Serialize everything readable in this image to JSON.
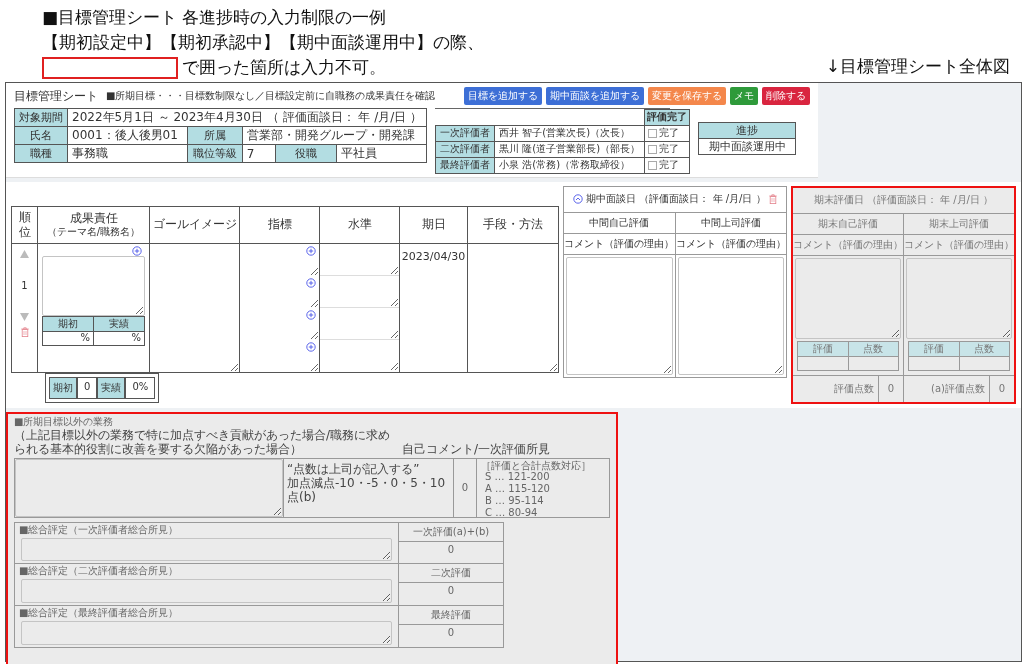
{
  "caption": {
    "title": "■目標管理シート 各進捗時の入力制限の一例",
    "line2": "【期初設定中】【期初承認中】【期中面談運用中】の際、",
    "line3": "で囲った箇所は入力不可。",
    "figure_label": "↓目標管理シート全体図"
  },
  "sheet": {
    "title": "目標管理シート",
    "note": "■所期目標・・・目標数制限なし／目標設定前に自職務の成果責任を確認",
    "buttons": [
      {
        "label": "目標を追加する",
        "color": "#3d6fd6"
      },
      {
        "label": "期中面談を追加する",
        "color": "#3d6fd6"
      },
      {
        "label": "変更を保存する",
        "color": "#f4874b"
      },
      {
        "label": "メモ",
        "color": "#2e9a3a"
      },
      {
        "label": "削除する",
        "color": "#d9253f"
      }
    ],
    "info": {
      "rows": [
        [
          {
            "label": "対象期間",
            "value": "2022年5月1日 ～ 2023年4月30日 （ 評価面談日： 年 /月/日 ）"
          }
        ],
        [
          {
            "label": "氏名",
            "value": "0001：後人後男01"
          },
          {
            "label": "所属",
            "value": "営業部・開発グループ・開発課"
          }
        ],
        [
          {
            "label": "職種",
            "value": "事務職"
          },
          {
            "label": "職位等級",
            "value": "7"
          },
          {
            "label": "役職",
            "value": "平社員"
          }
        ]
      ]
    },
    "evaluators": {
      "done_header": "評価完了",
      "rows": [
        {
          "role": "一次評価者",
          "name": "西井 智子(営業次長)（次長）",
          "done_label": "完了",
          "checked": false
        },
        {
          "role": "二次評価者",
          "name": "黒川 隆(道子営業部長)（部長）",
          "done_label": "完了",
          "checked": false
        },
        {
          "role": "最終評価者",
          "name": "小泉 浩(常務)（常務取締役）",
          "done_label": "完了",
          "checked": false
        }
      ]
    },
    "progress": {
      "label": "進捗",
      "value": "期中面談運用中"
    }
  },
  "goals": {
    "columns": [
      {
        "title": "順位"
      },
      {
        "title": "成果責任",
        "subtitle": "（テーマ名/職務名）"
      },
      {
        "title": "ゴールイメージ"
      },
      {
        "title": "指標"
      },
      {
        "title": "水準"
      },
      {
        "title": "期日"
      },
      {
        "title": "手段・方法"
      }
    ],
    "rows": [
      {
        "rank": "1",
        "due": "2023/04/30",
        "ratio": [
          {
            "label": "期初",
            "value": "%"
          },
          {
            "label": "実績",
            "value": "%"
          }
        ]
      }
    ],
    "summary": [
      {
        "label": "期初",
        "value": "0"
      },
      {
        "label": "実績",
        "value": "0%"
      }
    ]
  },
  "mid_panel": {
    "locked": false,
    "date_label": "期中面談日",
    "date_note": "（評価面談日： 年 /月/日 ）",
    "columns": [
      {
        "title": "中間自己評価",
        "comment": "コメント（評価の理由）"
      },
      {
        "title": "中間上司評価",
        "comment": "コメント（評価の理由）"
      }
    ]
  },
  "end_panel": {
    "locked": true,
    "date_label": "期末評価日",
    "date_note": "（評価面談日： 年 /月/日 ）",
    "columns": [
      {
        "title": "期末自己評価",
        "comment": "コメント（評価の理由）",
        "score_headers": [
          "評価",
          "点数"
        ],
        "total_label": "評価点数",
        "total": "0"
      },
      {
        "title": "期末上司評価",
        "comment": "コメント（評価の理由）",
        "score_headers": [
          "評価",
          "点数"
        ],
        "total_label": "(a)評価点数",
        "total": "0"
      }
    ]
  },
  "other_work": {
    "locked": true,
    "heading": "■所期目標以外の業務",
    "subheading": "（上記目標以外の業務で特に加点すべき貢献があった場合/職務に求められる基本的役割に改善を要する欠陥があった場合）",
    "comment_label": "自己コメント/一次評価所見",
    "score_note": [
      "“点数は上司が記入する”",
      "加点減点-10・-5・0・5・10点(b)"
    ],
    "score": "0",
    "legend_title": "［評価と合計点数対応］",
    "legend": [
      "S … 121-200",
      "A … 115-120",
      "B … 95-114",
      "C … 80-94"
    ],
    "overall": [
      {
        "label": "■総合評定（一次評価者総合所見）",
        "score_label": "一次評価(a)+(b)",
        "score": "0"
      },
      {
        "label": "■総合評定（二次評価者総合所見）",
        "score_label": "二次評価",
        "score": "0"
      },
      {
        "label": "■総合評定（最終評価者総合所見）",
        "score_label": "最終評価",
        "score": "0"
      }
    ]
  }
}
